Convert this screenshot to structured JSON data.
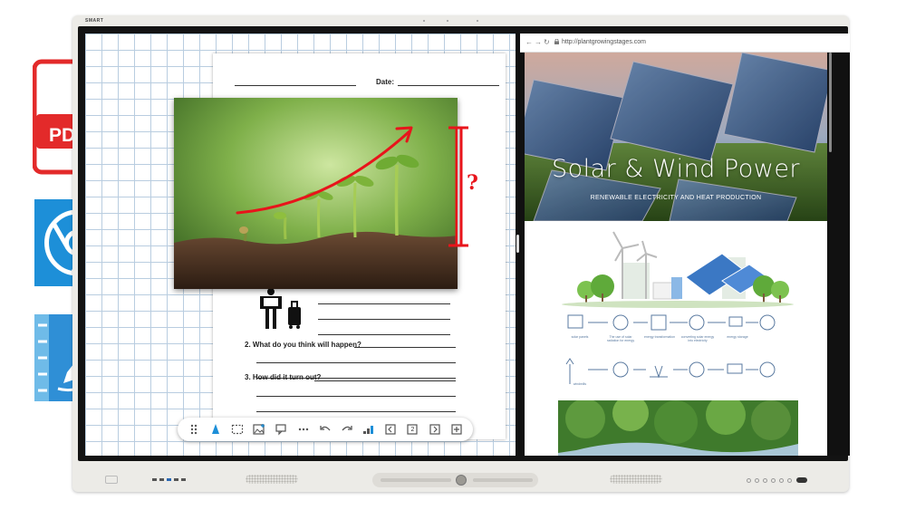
{
  "device": {
    "brand": "SMART"
  },
  "apps": {
    "pdf_label": "PDF"
  },
  "worksheet": {
    "date_label": "Date:",
    "q2": "2. What do you think will happen?",
    "q3": "3. How did it turn out?"
  },
  "annotation": {
    "question_mark": "?"
  },
  "browser": {
    "url": "http://plantgrowingstages.com",
    "hero_title": "Solar & Wind Power",
    "hero_subtitle": "RENEWABLE ELECTRICITY AND HEAT PRODUCTION",
    "info_captions": [
      "solar panels",
      "The use of solar radiation for energy",
      "energy transformation",
      "converting solar energy into electricity",
      "energy storage",
      "windmills"
    ]
  },
  "toolbar": {
    "items": [
      "drag-handle",
      "pen-tool",
      "select-tool",
      "add-image",
      "comment",
      "more",
      "undo",
      "redo",
      "activities",
      "prev-page",
      "page-number",
      "next-page",
      "add-page"
    ],
    "page_number": "2"
  },
  "colors": {
    "accent_blue": "#1d8fd8",
    "pdf_red": "#e32a2a",
    "annotation_red": "#e8141b"
  }
}
